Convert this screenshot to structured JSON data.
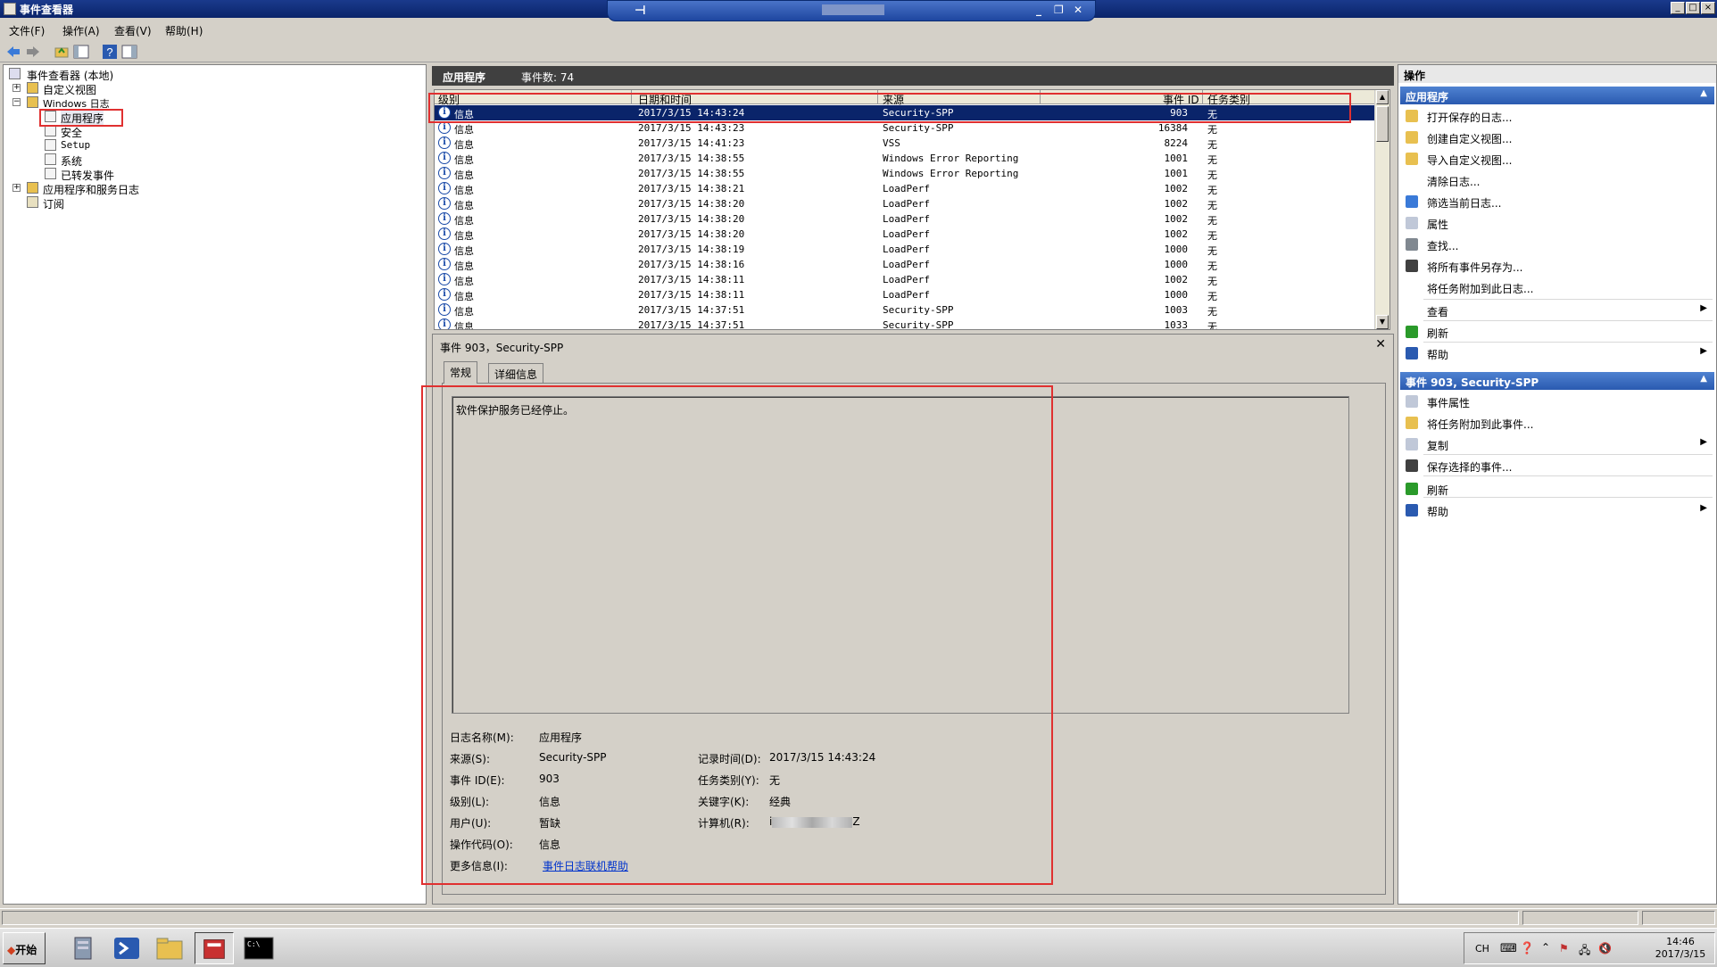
{
  "window": {
    "title": "事件查看器"
  },
  "menu": [
    "文件(F)",
    "操作(A)",
    "查看(V)",
    "帮助(H)"
  ],
  "tree": {
    "root": "事件查看器 (本地)",
    "custom_views": "自定义视图",
    "windows_logs": "Windows 日志",
    "application": "应用程序",
    "security": "安全",
    "setup": "Setup",
    "system": "系统",
    "forwarded": "已转发事件",
    "app_service_logs": "应用程序和服务日志",
    "subscriptions": "订阅"
  },
  "list": {
    "title": "应用程序",
    "count_label": "事件数: 74",
    "columns": [
      "级别",
      "日期和时间",
      "来源",
      "事件 ID",
      "任务类别"
    ],
    "rows": [
      {
        "level": "信息",
        "datetime": "2017/3/15 14:43:24",
        "source": "Security-SPP",
        "id": "903",
        "task": "无"
      },
      {
        "level": "信息",
        "datetime": "2017/3/15 14:43:23",
        "source": "Security-SPP",
        "id": "16384",
        "task": "无"
      },
      {
        "level": "信息",
        "datetime": "2017/3/15 14:41:23",
        "source": "VSS",
        "id": "8224",
        "task": "无"
      },
      {
        "level": "信息",
        "datetime": "2017/3/15 14:38:55",
        "source": "Windows Error Reporting",
        "id": "1001",
        "task": "无"
      },
      {
        "level": "信息",
        "datetime": "2017/3/15 14:38:55",
        "source": "Windows Error Reporting",
        "id": "1001",
        "task": "无"
      },
      {
        "level": "信息",
        "datetime": "2017/3/15 14:38:21",
        "source": "LoadPerf",
        "id": "1002",
        "task": "无"
      },
      {
        "level": "信息",
        "datetime": "2017/3/15 14:38:20",
        "source": "LoadPerf",
        "id": "1002",
        "task": "无"
      },
      {
        "level": "信息",
        "datetime": "2017/3/15 14:38:20",
        "source": "LoadPerf",
        "id": "1002",
        "task": "无"
      },
      {
        "level": "信息",
        "datetime": "2017/3/15 14:38:20",
        "source": "LoadPerf",
        "id": "1002",
        "task": "无"
      },
      {
        "level": "信息",
        "datetime": "2017/3/15 14:38:19",
        "source": "LoadPerf",
        "id": "1000",
        "task": "无"
      },
      {
        "level": "信息",
        "datetime": "2017/3/15 14:38:16",
        "source": "LoadPerf",
        "id": "1000",
        "task": "无"
      },
      {
        "level": "信息",
        "datetime": "2017/3/15 14:38:11",
        "source": "LoadPerf",
        "id": "1002",
        "task": "无"
      },
      {
        "level": "信息",
        "datetime": "2017/3/15 14:38:11",
        "source": "LoadPerf",
        "id": "1000",
        "task": "无"
      },
      {
        "level": "信息",
        "datetime": "2017/3/15 14:37:51",
        "source": "Security-SPP",
        "id": "1003",
        "task": "无"
      },
      {
        "level": "信息",
        "datetime": "2017/3/15 14:37:51",
        "source": "Security-SPP",
        "id": "1033",
        "task": "无"
      }
    ]
  },
  "detail": {
    "title": "事件 903，Security-SPP",
    "tabs": [
      "常规",
      "详细信息"
    ],
    "message": "软件保护服务已经停止。",
    "log_name_label": "日志名称(M):",
    "log_name": "应用程序",
    "source_label": "来源(S):",
    "source": "Security-SPP",
    "logged_label": "记录时间(D):",
    "logged": "2017/3/15 14:43:24",
    "event_id_label": "事件 ID(E):",
    "event_id": "903",
    "task_label": "任务类别(Y):",
    "task": "无",
    "level_label": "级别(L):",
    "level": "信息",
    "keywords_label": "关键字(K):",
    "keywords": "经典",
    "user_label": "用户(U):",
    "user": "暂缺",
    "computer_label": "计算机(R):",
    "computer_prefix": "i",
    "computer_suffix": "Z",
    "opcode_label": "操作代码(O):",
    "opcode": "信息",
    "more_label": "更多信息(I):",
    "more_link": "事件日志联机帮助"
  },
  "actions": {
    "title": "操作",
    "section1": "应用程序",
    "items1": [
      "打开保存的日志...",
      "创建自定义视图...",
      "导入自定义视图...",
      "清除日志...",
      "筛选当前日志...",
      "属性",
      "查找...",
      "将所有事件另存为...",
      "将任务附加到此日志...",
      "查看",
      "刷新",
      "帮助"
    ],
    "section2": "事件 903, Security-SPP",
    "items2": [
      "事件属性",
      "将任务附加到此事件...",
      "复制",
      "保存选择的事件...",
      "刷新",
      "帮助"
    ]
  },
  "taskbar": {
    "start": "开始",
    "lang": "CH",
    "time": "14:46",
    "date": "2017/3/15"
  },
  "colors": {
    "selection": "#0a246a",
    "section_header": "#3a6cc0",
    "annotation": "#e03030"
  }
}
